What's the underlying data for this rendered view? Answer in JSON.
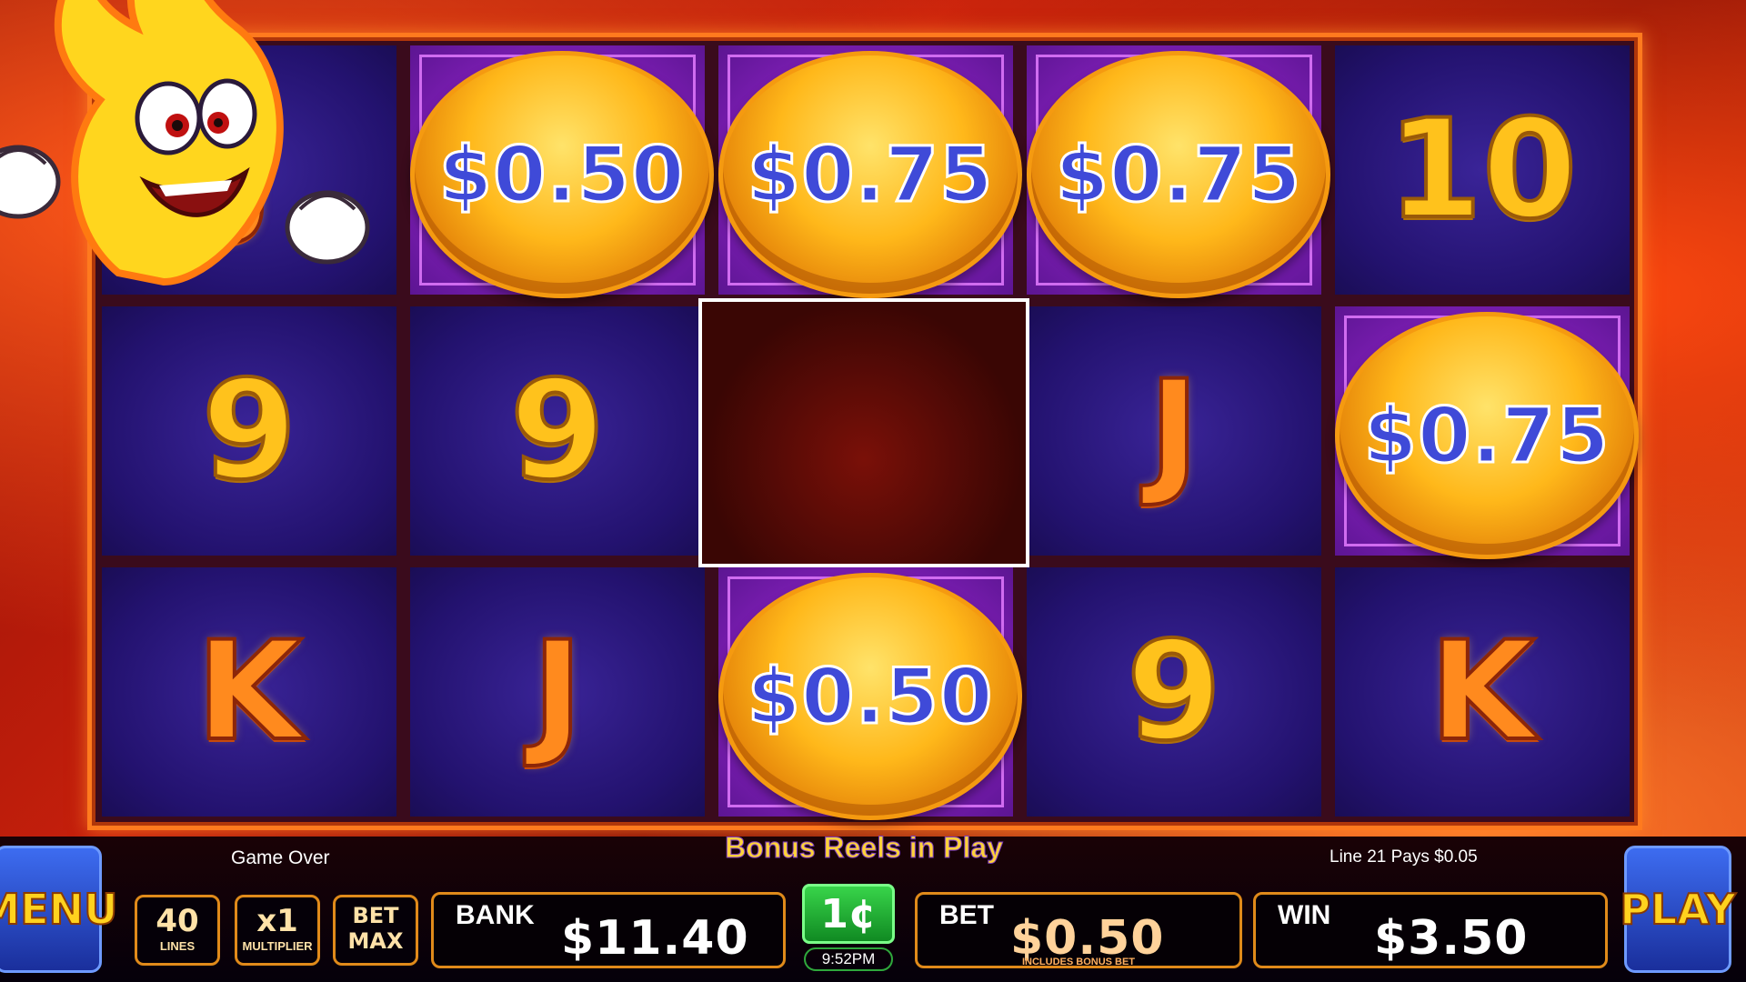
{
  "reels": {
    "rows": [
      [
        {
          "type": "symbol",
          "text": "J",
          "style": "orange"
        },
        {
          "type": "coin",
          "text": "$0.50"
        },
        {
          "type": "coin",
          "text": "$0.75"
        },
        {
          "type": "coin",
          "text": "$0.75"
        },
        {
          "type": "symbol",
          "text": "10",
          "style": "gold"
        }
      ],
      [
        {
          "type": "symbol",
          "text": "9",
          "style": "gold"
        },
        {
          "type": "symbol",
          "text": "9",
          "style": "gold"
        },
        {
          "type": "mascot",
          "text": ""
        },
        {
          "type": "symbol",
          "text": "J",
          "style": "orange"
        },
        {
          "type": "coin",
          "text": "$0.75"
        }
      ],
      [
        {
          "type": "symbol",
          "text": "K",
          "style": "orange"
        },
        {
          "type": "symbol",
          "text": "J",
          "style": "orange"
        },
        {
          "type": "coin",
          "text": "$0.50"
        },
        {
          "type": "symbol",
          "text": "9",
          "style": "gold"
        },
        {
          "type": "symbol",
          "text": "K",
          "style": "orange"
        }
      ]
    ]
  },
  "status": {
    "game_over": "Game Over",
    "bonus_reels": "Bonus Reels in Play",
    "line_pays": "Line  21 Pays $0.05"
  },
  "buttons": {
    "menu": "MENU",
    "play": "PLAY",
    "lines_value": "40",
    "lines_label": "LINES",
    "multiplier_value": "x1",
    "multiplier_label": "MULTIPLIER",
    "bet_max_line1": "BET",
    "bet_max_line2": "MAX",
    "denomination": "1¢"
  },
  "meters": {
    "bank_label": "BANK",
    "bank_value": "$11.40",
    "bet_label": "BET",
    "bet_value": "$0.50",
    "bet_note": "INCLUDES BONUS BET",
    "win_label": "WIN",
    "win_value": "$3.50"
  },
  "clock": "9:52PM",
  "colors": {
    "frame": "#ff7a1e",
    "cell_bg": "#23126f",
    "bonus_cell_bg": "#7d1eb4",
    "coin_text": "#3f4ad8",
    "accent_gold": "#ffd23a"
  }
}
